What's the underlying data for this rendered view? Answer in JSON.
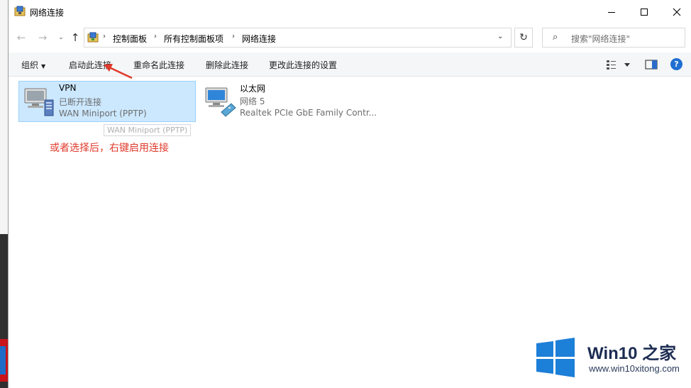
{
  "window": {
    "title": "网络连接"
  },
  "address": {
    "crumbs": [
      "控制面板",
      "所有控制面板项",
      "网络连接"
    ]
  },
  "search": {
    "placeholder": "搜索\"网络连接\""
  },
  "commands": {
    "organize": "组织",
    "start": "启动此连接",
    "rename": "重命名此连接",
    "delete": "删除此连接",
    "settings": "更改此连接的设置"
  },
  "connections": [
    {
      "name": "VPN",
      "status": "已断开连接",
      "device": "WAN Miniport (PPTP)",
      "selected": true
    },
    {
      "name": "以太网",
      "status": "网络 5",
      "device": "Realtek PCIe GbE Family Contr..."
    }
  ],
  "tooltip": {
    "text": "WAN Miniport (PPTP)"
  },
  "annotation": {
    "text": "或者选择后，右键启用连接",
    "color": "#e03a2c"
  },
  "watermark": {
    "brand": "Win10 之家",
    "url": "www.win10xitong.com"
  },
  "colors": {
    "selection": "#cce8ff",
    "help_blue": "#1f6fd1"
  }
}
